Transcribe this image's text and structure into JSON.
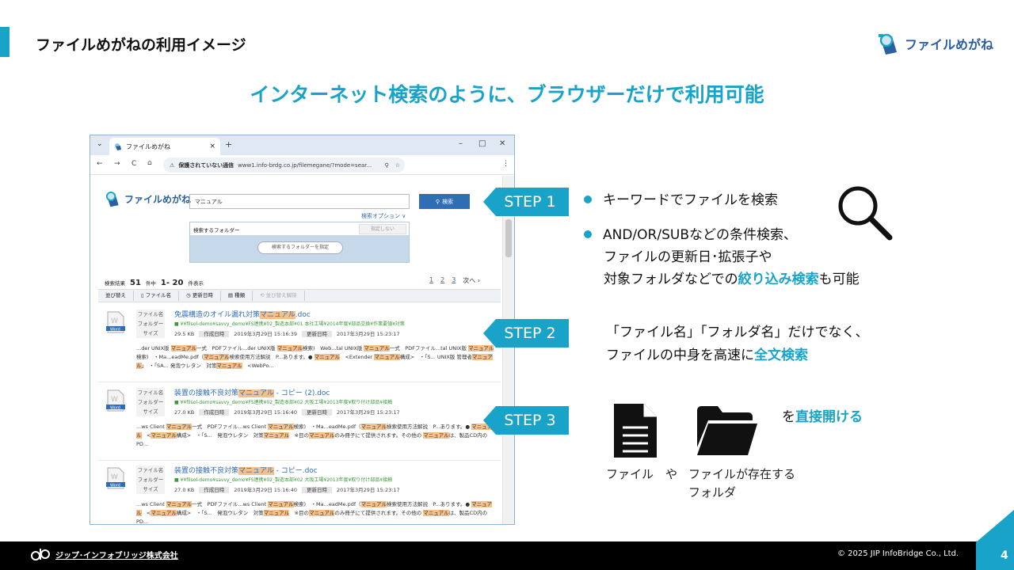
{
  "slide": {
    "title": "ファイルめがねの利用イメージ",
    "logo_text": "ファイルめがね",
    "headline": "インターネット検索のように、ブラウザーだけで利用可能",
    "accent_color": "#1aa3c8"
  },
  "browser": {
    "tab_title": "ファイルめがね",
    "tab_close": "×",
    "new_tab": "+",
    "win_min": "–",
    "win_max": "□",
    "win_close": "✕",
    "insecure_label": "保護されていない通信",
    "url": "www1.info-brdg.co.jp/filemegane/?mode=sear...",
    "nav": {
      "back": "←",
      "forward": "→",
      "reload": "C",
      "home": "⌂",
      "menu": "⋮"
    }
  },
  "app": {
    "logo_text": "ファイルめがね",
    "search_value": "マニュアル",
    "search_button": "検索",
    "search_options": "検索オプション ∨",
    "folder_label": "検索するフォルダー",
    "folder_unset": "指定しない",
    "folder_button": "検索するフォルダーを指定",
    "results_label": "検索結果",
    "results_count": "51",
    "results_unit": "件中",
    "results_range": "1- 20",
    "results_display": "件表示",
    "pages": [
      "1",
      "2",
      "3"
    ],
    "next": "次へ ›",
    "sort": {
      "label": "並び替え",
      "filename": "ファイル名",
      "updated": "更新日時",
      "type": "種類",
      "clear": "並び替え解除"
    },
    "meta_labels": {
      "filename": "ファイル名",
      "folder": "フォルダー",
      "size": "サイズ",
      "created": "作成日時",
      "updated": "更新日時"
    },
    "results": [
      {
        "name_pre": "免震構造のオイル漏れ対策",
        "name_hl": "マニュアル",
        "name_post": ".doc",
        "path": "■ ¥¥filsol-demo¥savvy_demo¥FS連携¥02_製造本部¥01 本社工場¥2014年度¥部品交換¥作業要領¥対策",
        "size": "29.5 KB",
        "created": "2019年3月29日 15:16:39",
        "updated": "2017年3月29日 15:23:17",
        "snippet": "...der UNIX版 マニュアル一式　PDFファイル...der UNIX版 マニュアル検索)　Web...tal UNIX版 マニュアル一式　PDFファイル...tal UNIX版 マニュアル検索)　・Ma...eadMe.pdf（マニュアル検索使用方法解説　P...あります。● マニュアル　<Extender マニュアル構成>　・「S... UNIX版 管理者マニュアル」　・「SA... 発泡ウレタン　対策マニュアル　<WebPo..."
      },
      {
        "name_pre": "装置の接触不良対策",
        "name_hl": "マニュアル",
        "name_post": " - コピー (2).doc",
        "path": "■ ¥¥filsol-demo¥savvy_demo¥FS連携¥02_製造本部¥02 大阪工場¥2013年度¥取り付け部品¥接触",
        "size": "27.0 KB",
        "created": "2019年3月29日 15:16:40",
        "updated": "2017年3月29日 15:23:17",
        "snippet": "...ws Client マニュアル一式　PDFファイル...ws Client マニュアル検索)　・Ma...eadMe.pdf（マニュアル検索使用方法解説　P...あります。● マニュアル　<マニュアル構成>　・「S...　発泡ウレタン　対策マニュアル　※目のマニュアルのみ冊子にて提供されます。その他の マニュアルは、製品CD内のPD..."
      },
      {
        "name_pre": "装置の接触不良対策",
        "name_hl": "マニュアル",
        "name_post": " - コピー.doc",
        "path": "■ ¥¥filsol-demo¥savvy_demo¥FS連携¥02_製造本部¥02 大阪工場¥2013年度¥取り付け部品¥接触",
        "size": "27.0 KB",
        "created": "2019年3月29日 15:16:40",
        "updated": "2017年3月29日 15:23:17",
        "snippet": "...ws Client マニュアル一式　PDFファイル...ws Client マニュアル検索)　・Ma...eadMe.pdf（マニュアル検索使用方法解説　P...あります。● マニュアル　<マニュアル構成>　・「S...　発泡ウレタン　対策マニュアル　※目のマニュアルのみ冊子にて提供されます。その他の マニュアルは、製品CD内のPD..."
      }
    ]
  },
  "steps": {
    "step1": "STEP 1",
    "step2": "STEP 2",
    "step3": "STEP 3",
    "bullet1": "キーワードでファイルを検索",
    "bullet2_line1": "AND/OR/SUBなどの条件検索、",
    "bullet2_line2": "ファイルの更新日･拡張子や",
    "bullet2_line3_pre": "対象フォルダなどでの",
    "bullet2_line3_em": "絞り込み検索",
    "bullet2_line3_post": "も可能",
    "step2_line1": "「ファイル名」「フォルダ名」だけでなく、",
    "step2_line2_pre": "ファイルの中身を高速に",
    "step2_line2_em": "全文検索",
    "step3_pre": "を",
    "step3_em": "直接開ける",
    "file_caption": "ファイル　や",
    "folder_caption_1": "ファイルが存在する",
    "folder_caption_2": "フォルダ",
    "icons": [
      "magnifier-icon",
      "document-icon",
      "folder-icon"
    ]
  },
  "footer": {
    "company": "ジップ･インフォブリッジ株式会社",
    "copyright": "© 2025 JIP InfoBridge Co., Ltd.",
    "page": "4"
  }
}
